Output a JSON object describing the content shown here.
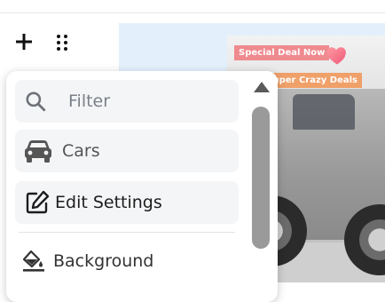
{
  "toolbar": {
    "add_icon": "plus-icon",
    "drag_icon": "drag-handle-icon"
  },
  "canvas": {
    "badges": {
      "deal": "Special Deal Now",
      "crazy": "Super Crazy Deals"
    },
    "heart_icon": "heart-icon"
  },
  "panel": {
    "filter": {
      "label": "Filter",
      "icon": "search-icon"
    },
    "items": [
      {
        "label": "Cars",
        "icon": "car-icon"
      },
      {
        "label": "Edit Settings",
        "icon": "edit-icon"
      },
      {
        "label": "Background",
        "icon": "paint-bucket-icon"
      }
    ],
    "scroll_icon": "scroll-up-arrow-icon"
  },
  "colors": {
    "deal_badge": "#ef8a8f",
    "crazy_badge": "#f0a069",
    "canvas_bg": "#e3f0fb",
    "item_bg": "#f4f5f7"
  }
}
